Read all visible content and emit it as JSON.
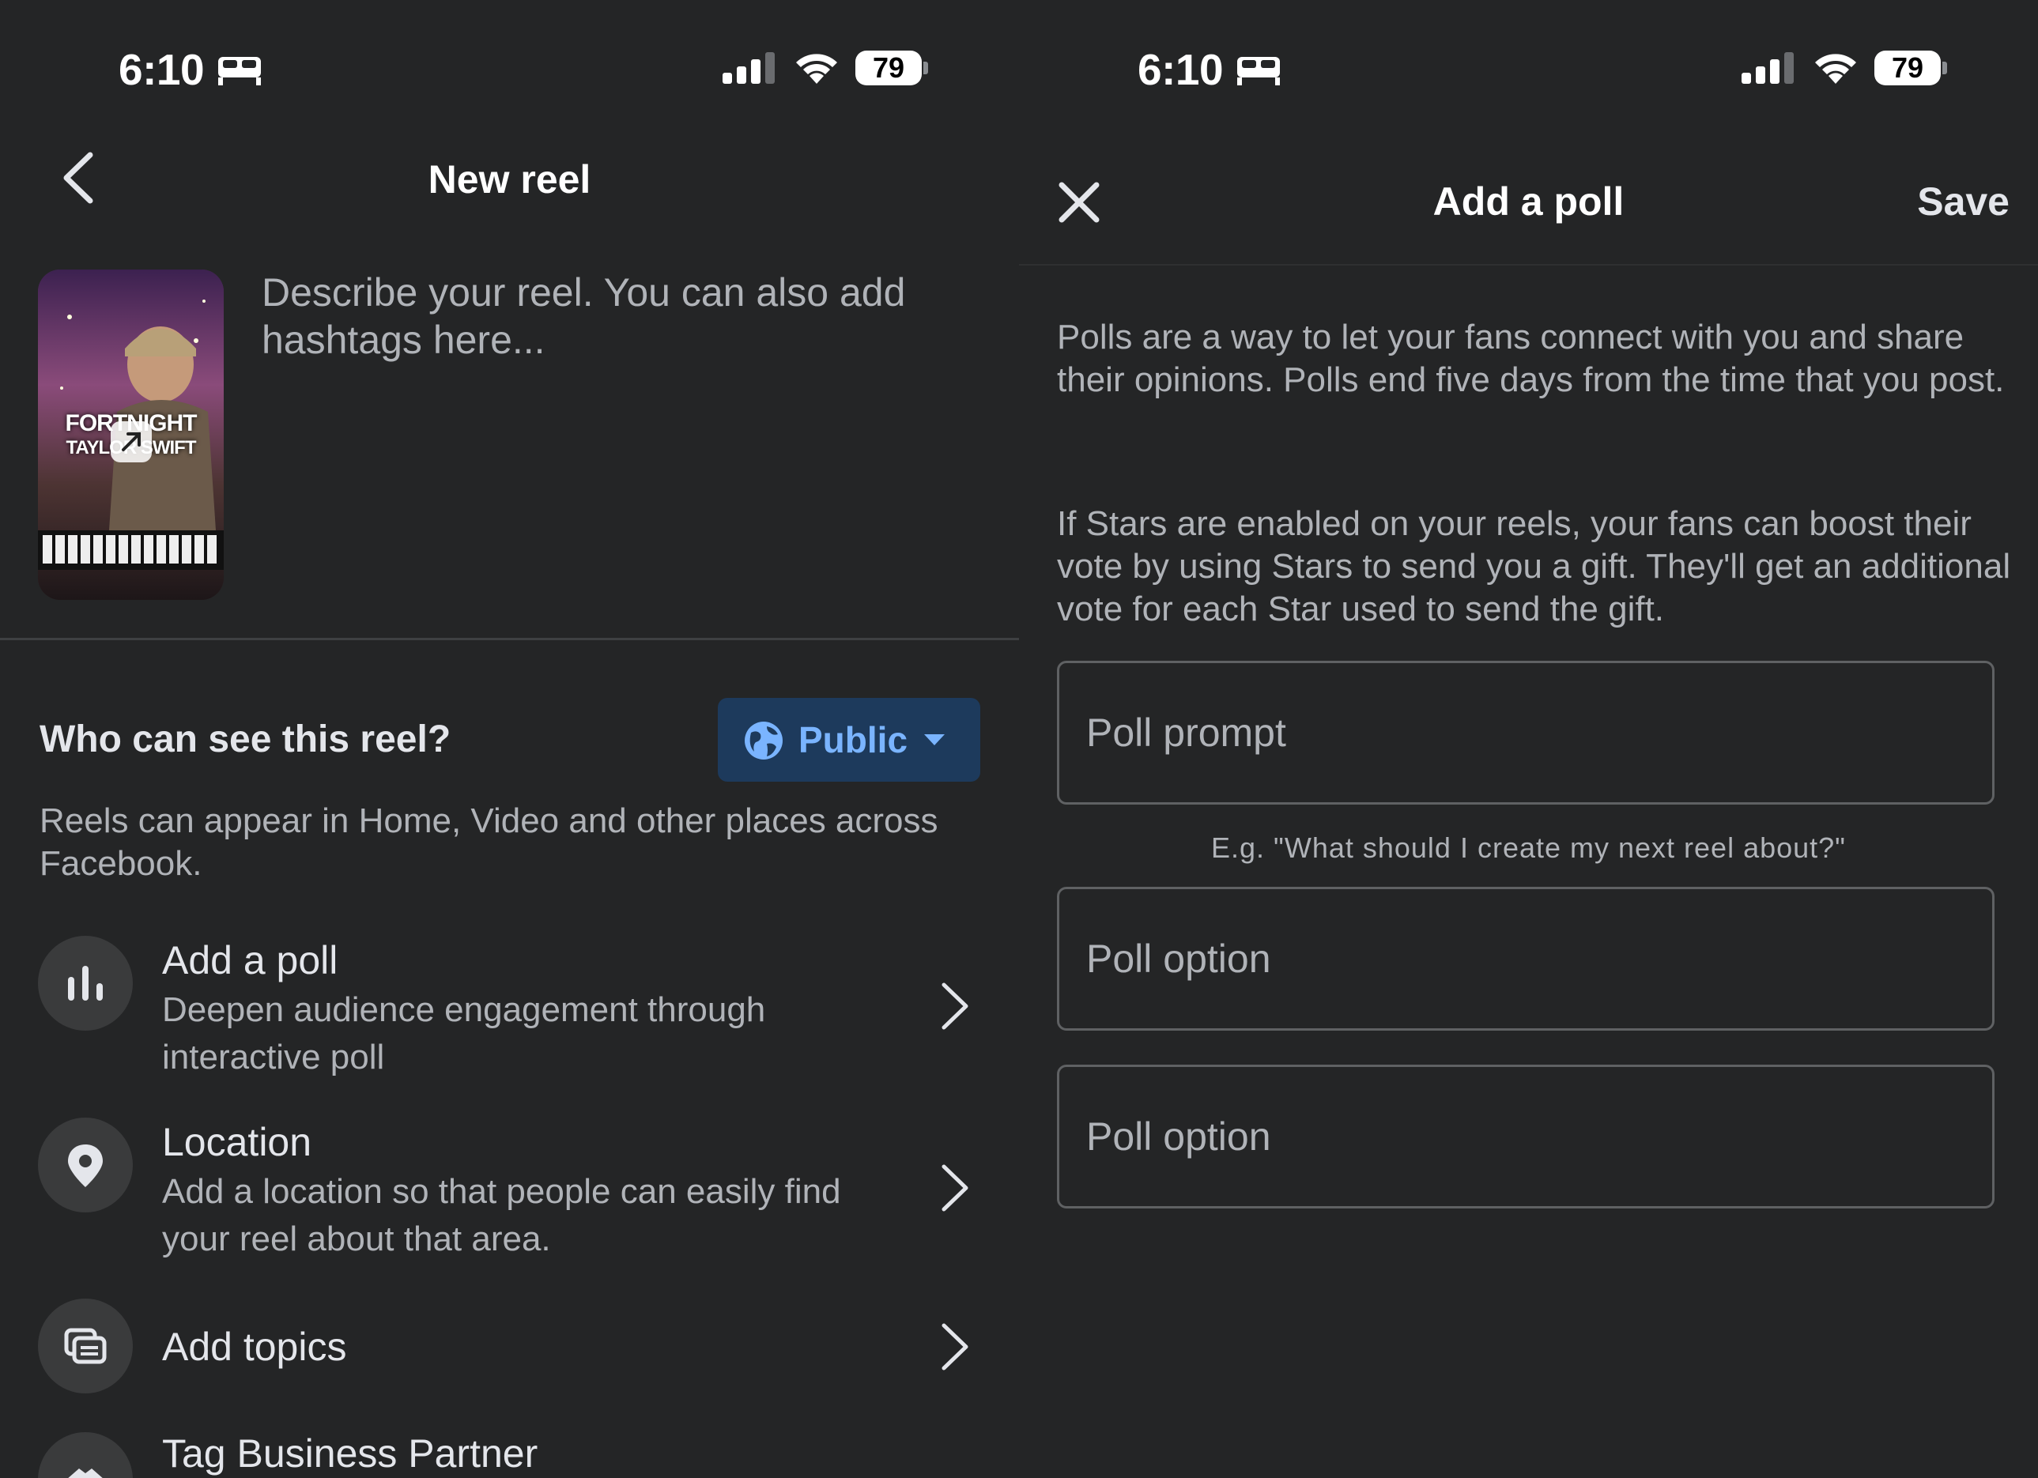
{
  "status_bar": {
    "time": "6:10",
    "battery": "79"
  },
  "new_reel": {
    "title": "New reel",
    "thumbnail_text_line1": "FORTNIGHT",
    "thumbnail_text_line2": "TAYLOR SWIFT",
    "description_placeholder": "Describe your reel. You can also add hashtags here...",
    "visibility": {
      "title": "Who can see this reel?",
      "button_label": "Public",
      "description": "Reels can appear in Home, Video and other places across Facebook."
    },
    "items": [
      {
        "title": "Add a poll",
        "subtitle": "Deepen audience engagement through interactive poll"
      },
      {
        "title": "Location",
        "subtitle": "Add a location so that people can easily find your reel about that area."
      },
      {
        "title": "Add topics",
        "subtitle": ""
      },
      {
        "title": "Tag Business Partner",
        "subtitle": ""
      }
    ]
  },
  "add_poll": {
    "title": "Add a poll",
    "save_label": "Save",
    "description_1": "Polls are a way to let your fans connect with you and share their opinions. Polls end five days from the time that you post.",
    "description_2": "If Stars are enabled on your reels, your fans can boost their vote by using Stars to send you a gift. They'll get an additional vote for each Star used to send the gift.",
    "prompt_placeholder": "Poll prompt",
    "prompt_hint": "E.g. \"What should I create my next reel about?\"",
    "option_placeholder_1": "Poll option",
    "option_placeholder_2": "Poll option"
  },
  "colors": {
    "background": "#242526",
    "public_button_bg": "#1d3a5c",
    "public_button_text": "#7ab4ff",
    "primary_text": "#e4e6eb",
    "secondary_text": "#b0b3b8"
  }
}
